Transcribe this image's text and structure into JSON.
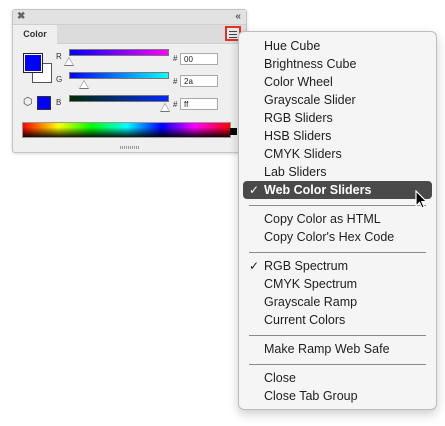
{
  "panel": {
    "close_glyph": "✖",
    "collapse_glyph": "‹‹",
    "tab_label": "Color",
    "fg_color": "#0000ff",
    "bg_color": "#ffffff",
    "hash_glyph": "#",
    "channels": [
      {
        "label": "R",
        "value": "00",
        "level": 0
      },
      {
        "label": "G",
        "value": "2a",
        "level": 0.16
      },
      {
        "label": "B",
        "value": "ff",
        "level": 1.0
      }
    ]
  },
  "menu": {
    "groups": [
      [
        {
          "label": "Hue Cube",
          "checked": false
        },
        {
          "label": "Brightness Cube",
          "checked": false
        },
        {
          "label": "Color Wheel",
          "checked": false
        },
        {
          "label": "Grayscale Slider",
          "checked": false
        },
        {
          "label": "RGB Sliders",
          "checked": false
        },
        {
          "label": "HSB Sliders",
          "checked": false
        },
        {
          "label": "CMYK Sliders",
          "checked": false
        },
        {
          "label": "Lab Sliders",
          "checked": false
        },
        {
          "label": "Web Color Sliders",
          "checked": true,
          "highlighted": true
        }
      ],
      [
        {
          "label": "Copy Color as HTML",
          "checked": false
        },
        {
          "label": "Copy Color's Hex Code",
          "checked": false
        }
      ],
      [
        {
          "label": "RGB Spectrum",
          "checked": true
        },
        {
          "label": "CMYK Spectrum",
          "checked": false
        },
        {
          "label": "Grayscale Ramp",
          "checked": false
        },
        {
          "label": "Current Colors",
          "checked": false
        }
      ],
      [
        {
          "label": "Make Ramp Web Safe",
          "checked": false
        }
      ],
      [
        {
          "label": "Close",
          "checked": false
        },
        {
          "label": "Close Tab Group",
          "checked": false
        }
      ]
    ],
    "check_glyph": "✓"
  }
}
